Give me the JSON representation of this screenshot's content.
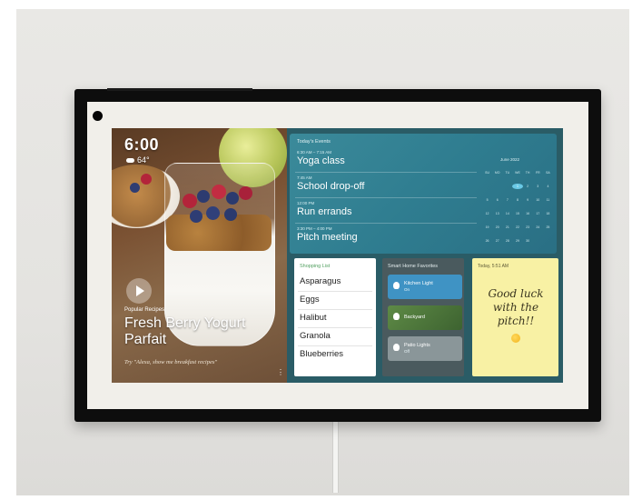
{
  "clock": {
    "time": "6:00",
    "weather_icon": "cloud-icon",
    "temperature": "64°"
  },
  "recipe": {
    "caption": "Popular Recipes",
    "title": "Fresh Berry Yogurt Parfait",
    "hint": "Try \"Alexa, show me breakfast recipes\"",
    "more": "⋮"
  },
  "events": {
    "header": "Today's Events",
    "items": [
      {
        "time": "6:30 AM – 7:15 AM",
        "name": "Yoga class"
      },
      {
        "time": "7:45 AM",
        "name": "School drop-off"
      },
      {
        "time": "12:00 PM",
        "name": "Run errands"
      },
      {
        "time": "3:30 PM – 4:00 PM",
        "name": "Pitch meeting"
      }
    ]
  },
  "calendar": {
    "month": "June 2022",
    "weekdays": [
      "SU",
      "MO",
      "TU",
      "WE",
      "TH",
      "FR",
      "SA"
    ],
    "days": [
      "",
      "",
      "",
      "1",
      "2",
      "3",
      "4",
      "5",
      "6",
      "7",
      "8",
      "9",
      "10",
      "11",
      "12",
      "13",
      "14",
      "15",
      "16",
      "17",
      "18",
      "19",
      "20",
      "21",
      "22",
      "23",
      "24",
      "25",
      "26",
      "27",
      "28",
      "29",
      "30",
      "",
      ""
    ],
    "today": "1"
  },
  "shopping": {
    "header": "Shopping List",
    "items": [
      "Asparagus",
      "Eggs",
      "Halibut",
      "Granola",
      "Blueberries"
    ]
  },
  "smart_home": {
    "header": "Smart Home Favorites",
    "tiles": [
      {
        "name": "Kitchen Light",
        "state": "On",
        "color": "#3f93c4"
      },
      {
        "name": "Backyard",
        "state": "",
        "color": "#4f7a3c"
      },
      {
        "name": "Patio Lights",
        "state": "Off",
        "color": "#8a9699"
      }
    ]
  },
  "note": {
    "header": "Today, 5:51 AM",
    "text": "Good luck with the pitch!!",
    "emoji": "winking-face-icon"
  },
  "colors": {
    "screen_bg": "#2a5c66",
    "events_bg": "#2f7d90",
    "note_bg": "#f8f1a4",
    "device_frame": "#0d0d0d"
  }
}
